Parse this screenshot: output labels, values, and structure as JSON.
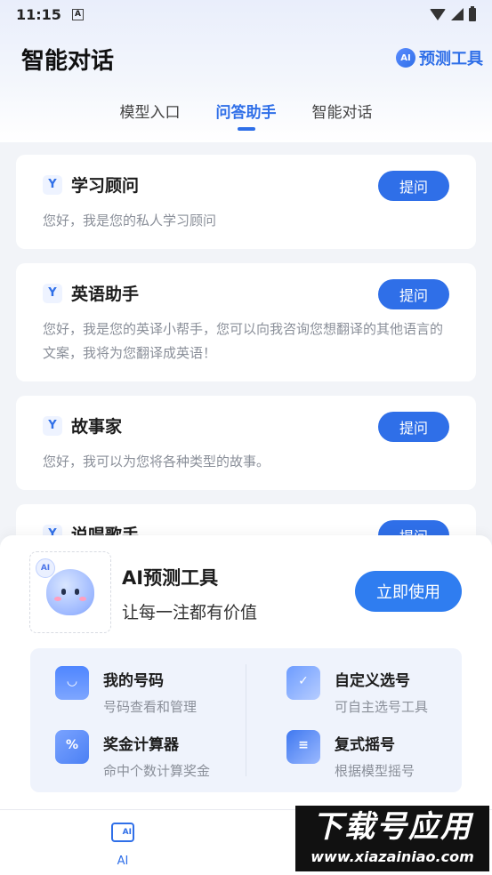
{
  "status_bar": {
    "time": "11:15",
    "notif_icon": "A"
  },
  "header": {
    "title": "智能对话",
    "predict_link": "预测工具",
    "badge": "AI"
  },
  "tabs": [
    {
      "label": "模型入口",
      "active": false
    },
    {
      "label": "问答助手",
      "active": true
    },
    {
      "label": "智能对话",
      "active": false
    }
  ],
  "cards": [
    {
      "icon": "Y",
      "title": "学习顾问",
      "button": "提问",
      "desc": "您好，我是您的私人学习顾问"
    },
    {
      "icon": "Y",
      "title": "英语助手",
      "button": "提问",
      "desc": "您好，我是您的英译小帮手，您可以向我咨询您想翻译的其他语言的文案，我将为您翻译成英语！"
    },
    {
      "icon": "Y",
      "title": "故事家",
      "button": "提问",
      "desc": "您好，我可以为您将各种类型的故事。"
    },
    {
      "icon": "Y",
      "title": "说唱歌手",
      "button": "提问",
      "desc": ""
    }
  ],
  "promo": {
    "mascot_tag": "AI",
    "title": "AI预测工具",
    "subtitle": "让每一注都有价值",
    "button": "立即使用",
    "features": [
      {
        "name": "我的号码",
        "desc": "号码查看和管理"
      },
      {
        "name": "自定义选号",
        "desc": "可自主选号工具"
      },
      {
        "name": "奖金计算器",
        "desc": "命中个数计算奖金"
      },
      {
        "name": "复式摇号",
        "desc": "根据模型摇号"
      }
    ]
  },
  "bottom_nav": {
    "ai_label": "AI",
    "ai_icon_text": "AI"
  },
  "watermark": {
    "main": "下载号应用",
    "sub": "www.xiazainiao.com"
  }
}
